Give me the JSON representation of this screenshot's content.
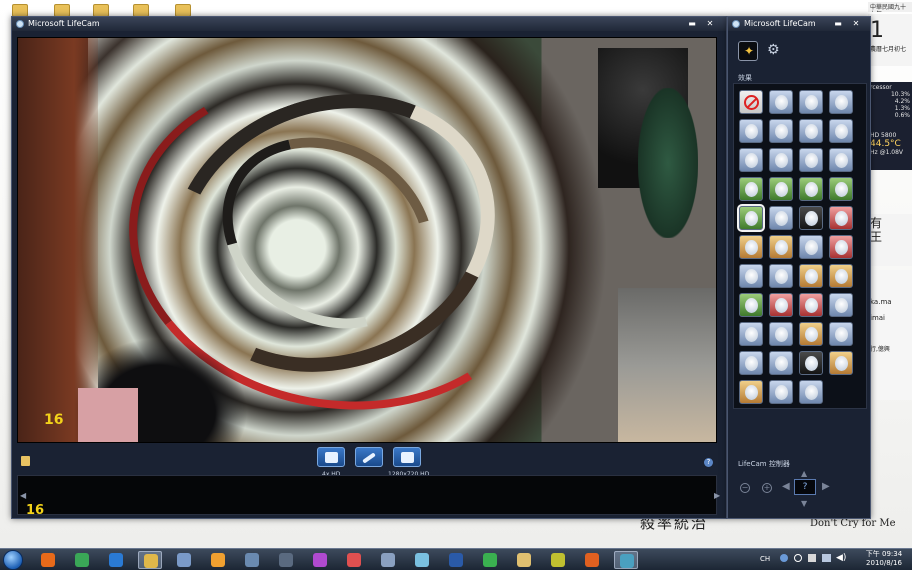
{
  "main_window": {
    "title": "Microsoft LifeCam",
    "minimize_label": "▬",
    "close_label": "✕",
    "fps_overlay": "16",
    "strip_fps": "16",
    "controls": [
      {
        "name": "photo-button",
        "label": "4x HD"
      },
      {
        "name": "pen-button",
        "label": ""
      },
      {
        "name": "video-button",
        "label": "1280x720 HD"
      }
    ],
    "help_label": "?"
  },
  "side_panel": {
    "title": "Microsoft LifeCam",
    "minimize_label": "▬",
    "close_label": "✕",
    "effects_label": "效果",
    "effects": [
      {
        "name": "no-effect",
        "style": "none",
        "selected": false
      },
      {
        "name": "effect-1",
        "style": "blue"
      },
      {
        "name": "effect-2",
        "style": "blue"
      },
      {
        "name": "effect-3",
        "style": "blue"
      },
      {
        "name": "effect-4",
        "style": "blue"
      },
      {
        "name": "effect-5",
        "style": "blue"
      },
      {
        "name": "effect-6",
        "style": "blue"
      },
      {
        "name": "effect-7",
        "style": "blue"
      },
      {
        "name": "effect-8",
        "style": "blue"
      },
      {
        "name": "effect-9",
        "style": "blue"
      },
      {
        "name": "effect-10",
        "style": "blue"
      },
      {
        "name": "effect-11",
        "style": "blue"
      },
      {
        "name": "effect-12",
        "style": "green"
      },
      {
        "name": "effect-13",
        "style": "green"
      },
      {
        "name": "effect-14",
        "style": "green"
      },
      {
        "name": "effect-15",
        "style": "green"
      },
      {
        "name": "effect-swirl",
        "style": "green",
        "selected": true
      },
      {
        "name": "effect-17",
        "style": "blue"
      },
      {
        "name": "effect-18",
        "style": "dark"
      },
      {
        "name": "effect-19",
        "style": "red"
      },
      {
        "name": "effect-20",
        "style": "warm"
      },
      {
        "name": "effect-21",
        "style": "warm"
      },
      {
        "name": "effect-22",
        "style": "blue"
      },
      {
        "name": "effect-23",
        "style": "red"
      },
      {
        "name": "effect-24",
        "style": "blue"
      },
      {
        "name": "effect-25",
        "style": "blue"
      },
      {
        "name": "effect-26",
        "style": "warm"
      },
      {
        "name": "effect-27",
        "style": "warm"
      },
      {
        "name": "effect-28",
        "style": "green"
      },
      {
        "name": "effect-29",
        "style": "red"
      },
      {
        "name": "effect-30",
        "style": "red"
      },
      {
        "name": "effect-31",
        "style": "blue"
      },
      {
        "name": "effect-32",
        "style": "blue"
      },
      {
        "name": "effect-33",
        "style": "blue"
      },
      {
        "name": "effect-34",
        "style": "warm"
      },
      {
        "name": "effect-35",
        "style": "blue"
      },
      {
        "name": "effect-36",
        "style": "blue"
      },
      {
        "name": "effect-37",
        "style": "blue"
      },
      {
        "name": "effect-38",
        "style": "dark"
      },
      {
        "name": "effect-39",
        "style": "warm"
      },
      {
        "name": "effect-40",
        "style": "warm"
      },
      {
        "name": "effect-41",
        "style": "blue"
      },
      {
        "name": "effect-42",
        "style": "blue"
      }
    ],
    "dashboard_label": "LifeCam 控制器",
    "zoom_out_label": "−",
    "zoom_in_label": "+",
    "face_track_label": "?"
  },
  "desktop": {
    "doodle_text": "殺率統治",
    "english_text": "Don't Cry for Me",
    "gadgets": [
      "中華民國九十九年",
      "1",
      "農曆七月初七",
      "rcessor",
      "10.3%",
      "4.2%",
      "1.3%",
      "0.6%",
      "HD 5800",
      "44.5°C",
      "Hz @1.08V",
      "有",
      "王",
      "ka.ma",
      "imai",
      "行,億興"
    ]
  },
  "taskbar": {
    "tray_text": "CH",
    "time": "下午 09:34",
    "date": "2010/8/16",
    "apps": [
      {
        "name": "firefox",
        "color": "#e86a1a"
      },
      {
        "name": "chrome",
        "color": "#3aa757"
      },
      {
        "name": "ie",
        "color": "#2a7ad4"
      },
      {
        "name": "explorer",
        "color": "#e0b84a",
        "active": true
      },
      {
        "name": "network",
        "color": "#7a9ac8"
      },
      {
        "name": "media-player",
        "color": "#f0a030"
      },
      {
        "name": "app-7",
        "color": "#6a8ab0"
      },
      {
        "name": "steam",
        "color": "#5a6a80"
      },
      {
        "name": "picasa",
        "color": "#b04ad0"
      },
      {
        "name": "paint",
        "color": "#e05050"
      },
      {
        "name": "calculator",
        "color": "#8aa0c0"
      },
      {
        "name": "notes",
        "color": "#7ac0e0"
      },
      {
        "name": "word",
        "color": "#2a5aa8"
      },
      {
        "name": "messenger",
        "color": "#3ab050"
      },
      {
        "name": "folder-2",
        "color": "#e0c070"
      },
      {
        "name": "media-3",
        "color": "#c0c030"
      },
      {
        "name": "firefox-2",
        "color": "#e06020"
      },
      {
        "name": "lifecam",
        "color": "#4aa0c0",
        "active": true
      }
    ]
  }
}
